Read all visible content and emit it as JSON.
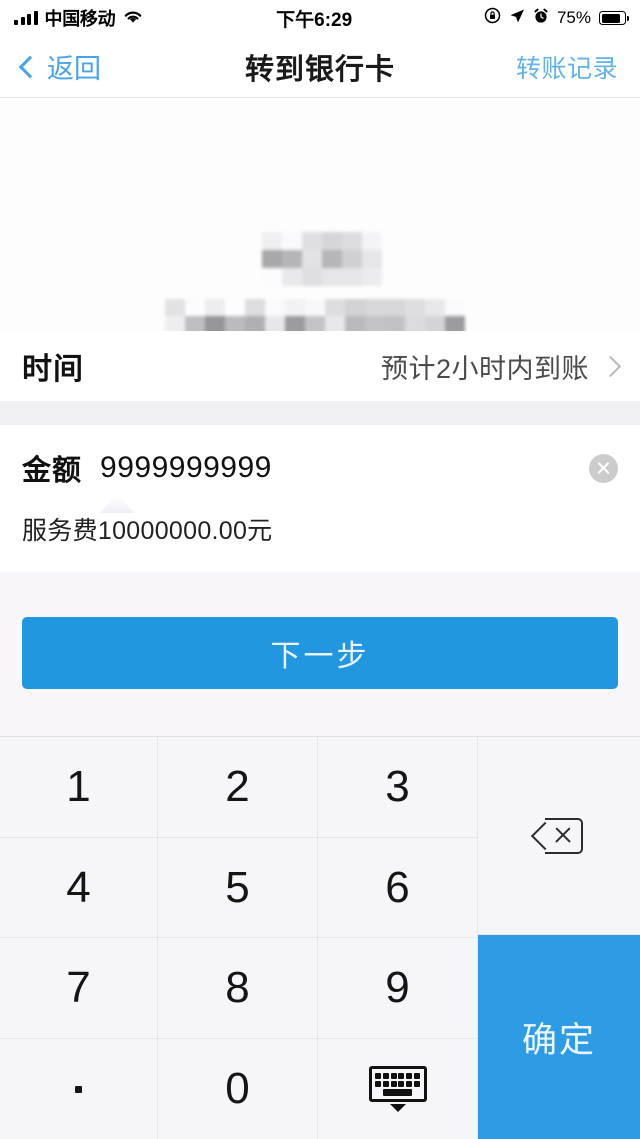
{
  "status_bar": {
    "carrier": "中国移动",
    "time": "下午6:29",
    "battery_percent": "75%",
    "icons": [
      "signal-bars-icon",
      "wifi-icon",
      "rotation-lock-icon",
      "location-arrow-icon",
      "alarm-clock-icon",
      "battery-icon"
    ]
  },
  "nav_bar": {
    "back_label": "返回",
    "title": "转到银行卡",
    "right_action_label": "转账记录",
    "accent_color": "#4aa3e8"
  },
  "card_section": {
    "redacted": true,
    "note": "mosaic-censored bank card information"
  },
  "time_row": {
    "label": "时间",
    "value": "预计2小时内到账"
  },
  "amount_section": {
    "label": "金额",
    "value": "9999999999",
    "placeholder": "请输入金额",
    "fee_text": "服务费10000000.00元",
    "clear_icon": "clear-circle-icon"
  },
  "cta": {
    "label": "下一步",
    "color": "#2396e0"
  },
  "keypad": {
    "keys": [
      "1",
      "2",
      "3",
      "4",
      "5",
      "6",
      "7",
      "8",
      "9",
      ".",
      "0"
    ],
    "backspace_icon": "backspace-icon",
    "dismiss_icon": "keyboard-dismiss-icon",
    "confirm_label": "确定",
    "confirm_color": "#2e9ce4"
  }
}
